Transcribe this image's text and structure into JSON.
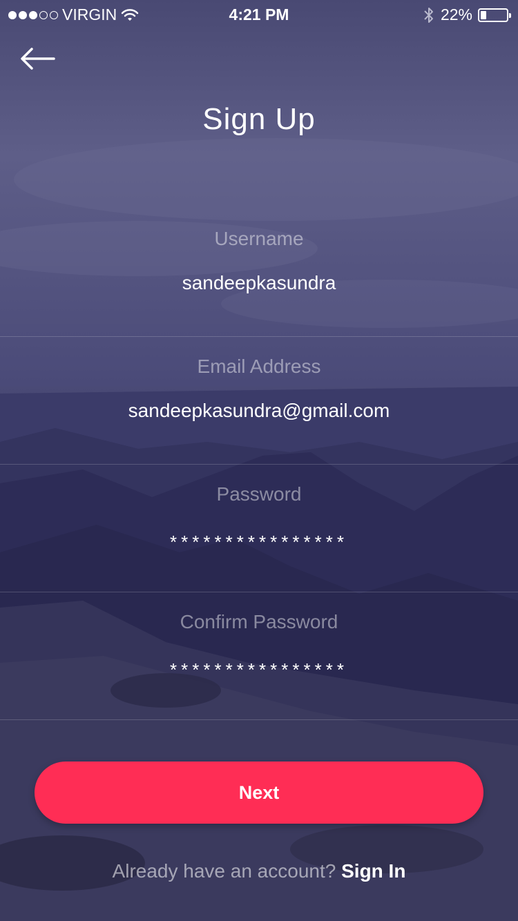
{
  "status_bar": {
    "carrier": "VIRGIN",
    "time": "4:21 PM",
    "battery_percent": "22%",
    "battery_level": 0.22
  },
  "header": {
    "title": "Sign Up"
  },
  "form": {
    "username": {
      "label": "Username",
      "value": "sandeepkasundra"
    },
    "email": {
      "label": "Email Address",
      "value": "sandeepkasundra@gmail.com"
    },
    "password": {
      "label": "Password",
      "value": "****************"
    },
    "confirm_password": {
      "label": "Confirm Password",
      "value": "****************"
    }
  },
  "actions": {
    "next_label": "Next"
  },
  "footer": {
    "prompt": "Already have an account? ",
    "signin_label": "Sign In"
  },
  "colors": {
    "accent": "#ff2d55",
    "background": "#3a3a66"
  }
}
